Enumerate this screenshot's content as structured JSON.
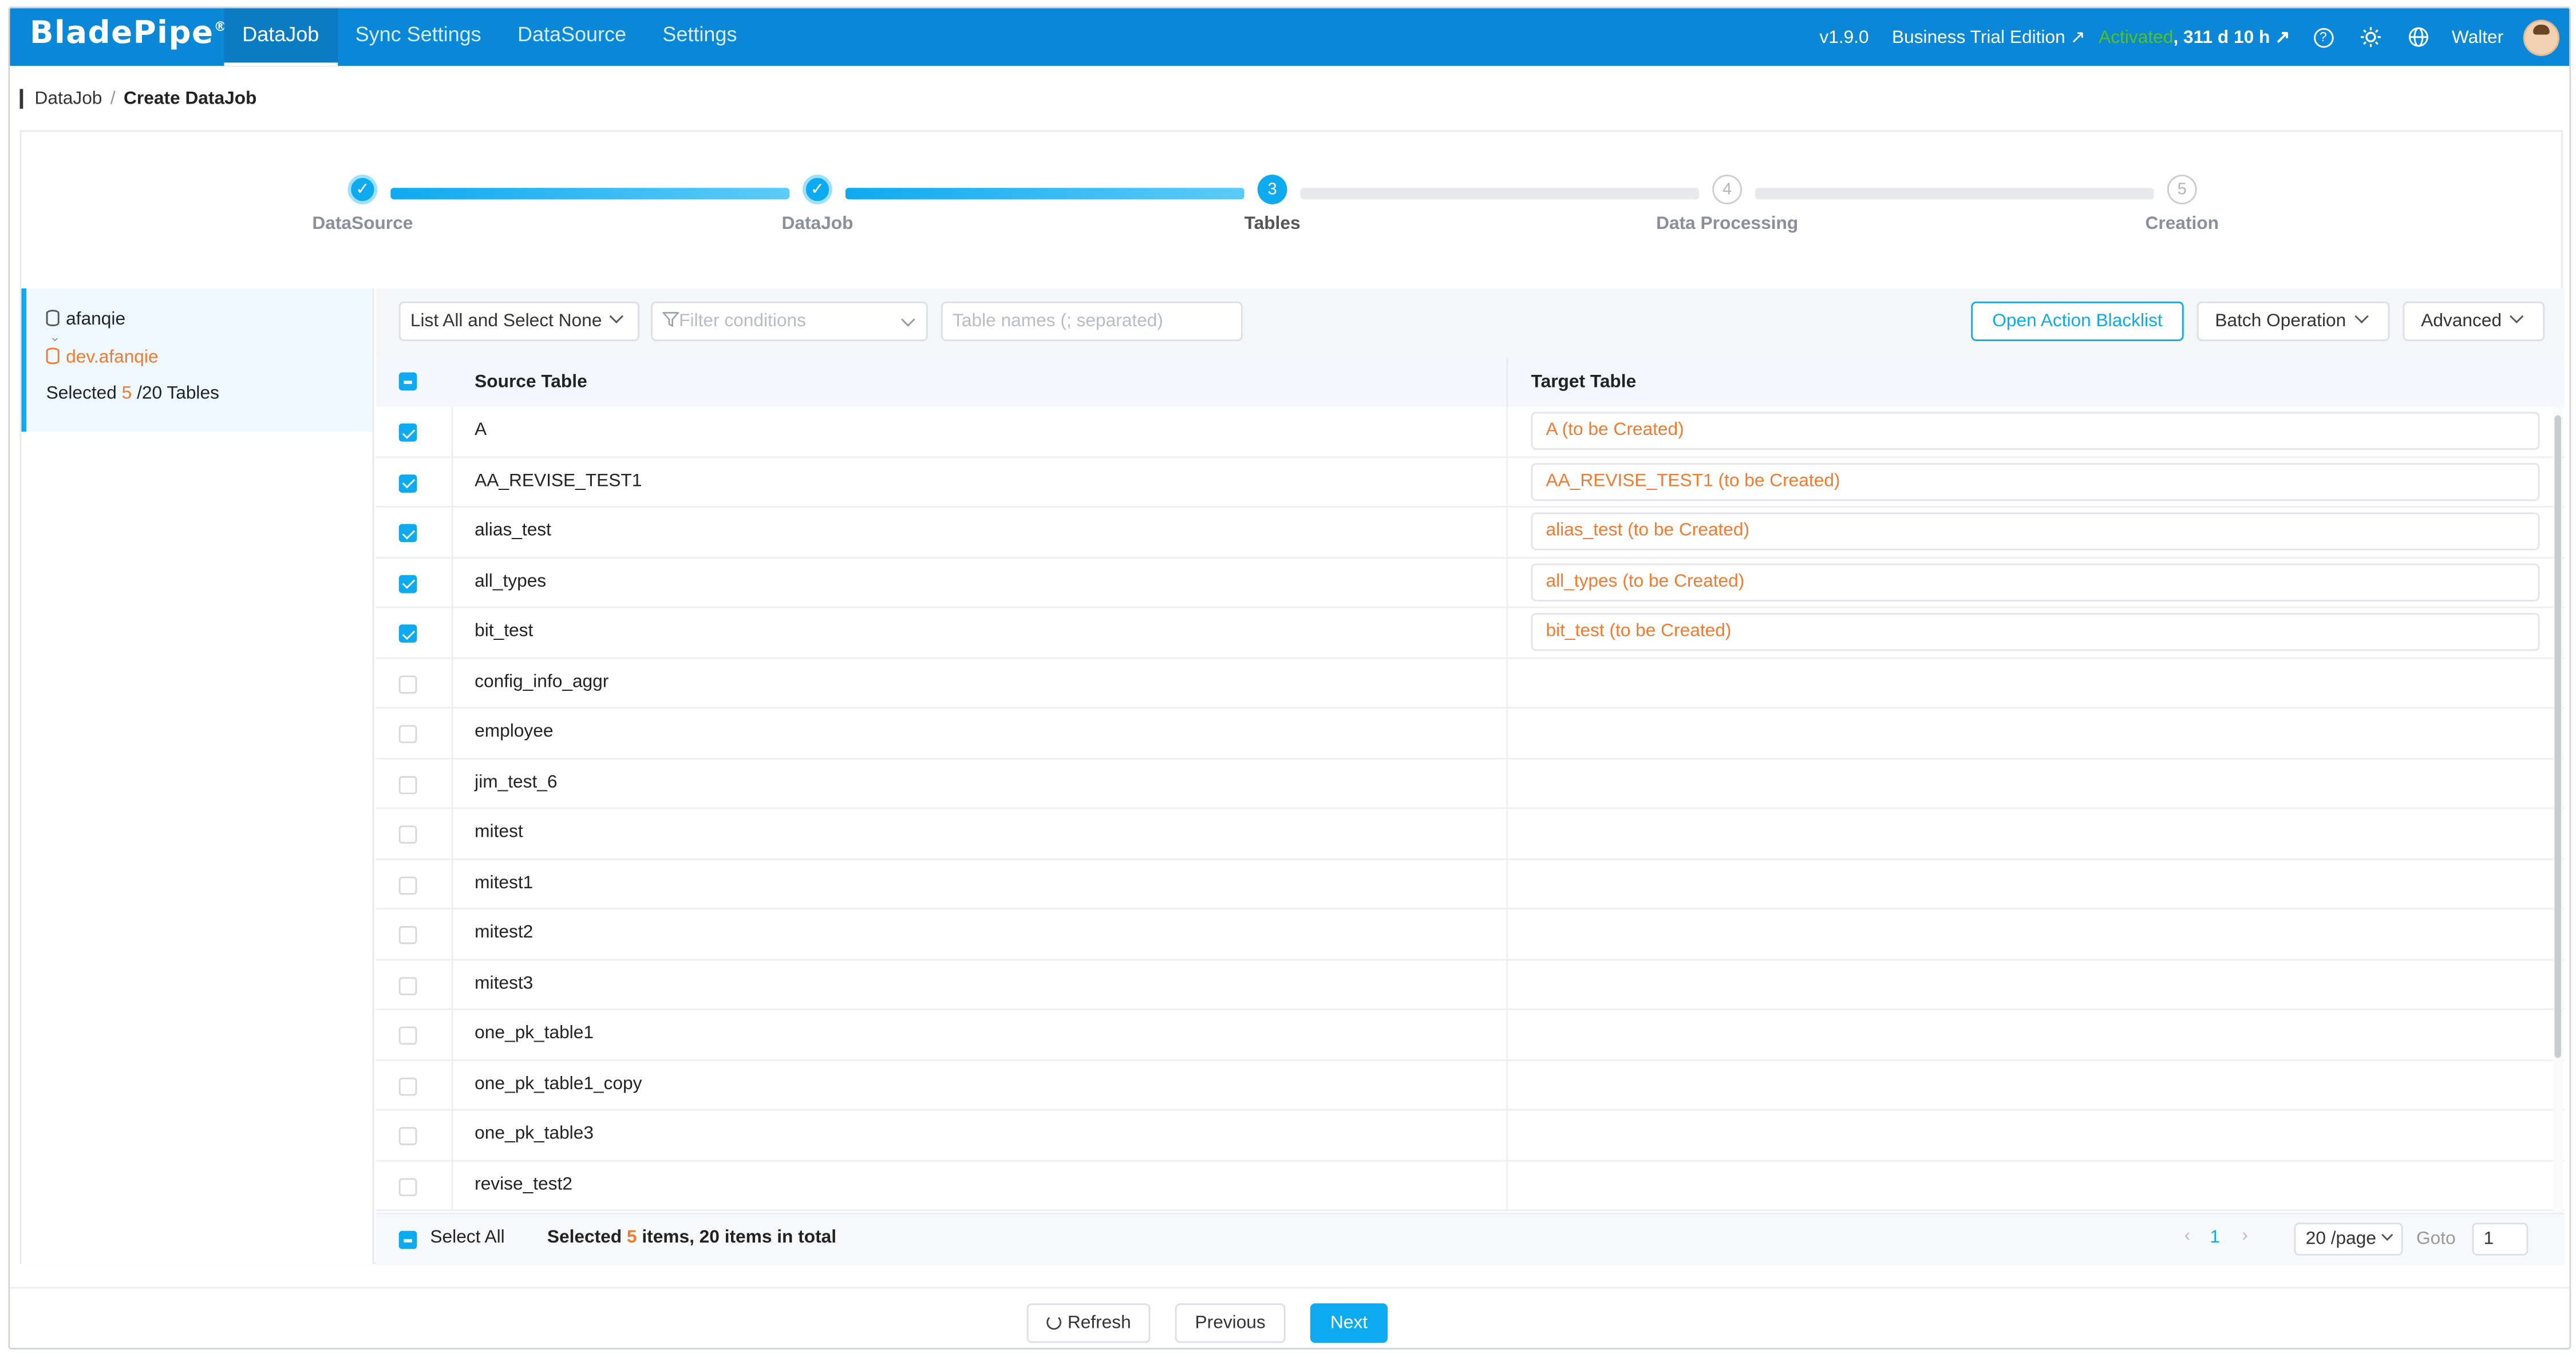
{
  "app": {
    "logo": "BladePipe",
    "logo_mark": "®"
  },
  "nav": [
    {
      "label": "DataJob",
      "active": true
    },
    {
      "label": "Sync Settings",
      "active": false
    },
    {
      "label": "DataSource",
      "active": false
    },
    {
      "label": "Settings",
      "active": false
    }
  ],
  "header_right": {
    "version": "v1.9.0",
    "edition": "Business Trial Edition ↗",
    "activated": "Activated",
    "remaining": ", 311 d 10 h ↗",
    "help_icon": "?",
    "user": "Walter"
  },
  "breadcrumb": {
    "root": "DataJob",
    "sep": "/",
    "current": "Create DataJob"
  },
  "steps": [
    {
      "label": "DataSource",
      "num": "1",
      "status": "done"
    },
    {
      "label": "DataJob",
      "num": "2",
      "status": "done"
    },
    {
      "label": "Tables",
      "num": "3",
      "status": "current"
    },
    {
      "label": "Data Processing",
      "num": "4",
      "status": "wait"
    },
    {
      "label": "Creation",
      "num": "5",
      "status": "wait"
    }
  ],
  "left_panel": {
    "source_name": "afanqie",
    "source_db": "dev.afanqie",
    "selected_prefix": "Selected ",
    "selected_count": "5",
    "selected_suffix": " /20 Tables"
  },
  "toolbar": {
    "list_mode": "List All and Select None",
    "filter_placeholder": "Filter conditions",
    "table_names_placeholder": "Table names (; separated)",
    "blacklist": "Open Action Blacklist",
    "batch": "Batch Operation",
    "advanced": "Advanced"
  },
  "table": {
    "headers": {
      "source": "Source Table",
      "target": "Target Table"
    },
    "rows": [
      {
        "source": "A",
        "checked": true,
        "target": "A (to be Created)"
      },
      {
        "source": "AA_REVISE_TEST1",
        "checked": true,
        "target": "AA_REVISE_TEST1 (to be Created)"
      },
      {
        "source": "alias_test",
        "checked": true,
        "target": "alias_test (to be Created)"
      },
      {
        "source": "all_types",
        "checked": true,
        "target": "all_types (to be Created)"
      },
      {
        "source": "bit_test",
        "checked": true,
        "target": "bit_test (to be Created)"
      },
      {
        "source": "config_info_aggr",
        "checked": false,
        "target": ""
      },
      {
        "source": "employee",
        "checked": false,
        "target": ""
      },
      {
        "source": "jim_test_6",
        "checked": false,
        "target": ""
      },
      {
        "source": "mitest",
        "checked": false,
        "target": ""
      },
      {
        "source": "mitest1",
        "checked": false,
        "target": ""
      },
      {
        "source": "mitest2",
        "checked": false,
        "target": ""
      },
      {
        "source": "mitest3",
        "checked": false,
        "target": ""
      },
      {
        "source": "one_pk_table1",
        "checked": false,
        "target": ""
      },
      {
        "source": "one_pk_table1_copy",
        "checked": false,
        "target": ""
      },
      {
        "source": "one_pk_table3",
        "checked": false,
        "target": ""
      },
      {
        "source": "revise_test2",
        "checked": false,
        "target": ""
      }
    ]
  },
  "footer": {
    "select_all": "Select All",
    "selected_prefix": "Selected ",
    "selected_count": "5",
    "selected_suffix": " items, 20 items in total",
    "page_prev": "‹",
    "page": "1",
    "page_next": "›",
    "page_size": "20 /page",
    "goto_label": "Goto",
    "goto_value": "1"
  },
  "actions": {
    "refresh": "Refresh",
    "previous": "Previous",
    "next": "Next"
  },
  "colors": {
    "topbar": "#0a87d6",
    "accent": "#0eaaf0",
    "orange": "#f07b31",
    "activated": "#52c41a"
  }
}
